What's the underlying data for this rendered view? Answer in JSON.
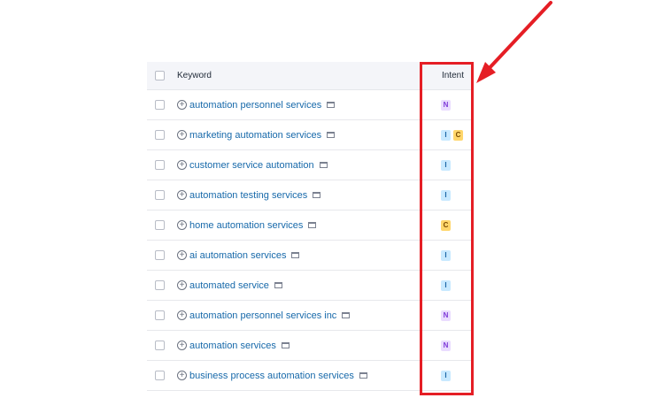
{
  "table": {
    "header": {
      "keyword_label": "Keyword",
      "intent_label": "Intent"
    },
    "rows": [
      {
        "keyword": "automation personnel services",
        "intents": [
          "N"
        ]
      },
      {
        "keyword": "marketing automation services",
        "intents": [
          "I",
          "C"
        ]
      },
      {
        "keyword": "customer service automation",
        "intents": [
          "I"
        ]
      },
      {
        "keyword": "automation testing services",
        "intents": [
          "I"
        ]
      },
      {
        "keyword": "home automation services",
        "intents": [
          "C"
        ]
      },
      {
        "keyword": "ai automation services",
        "intents": [
          "I"
        ]
      },
      {
        "keyword": "automated service",
        "intents": [
          "I"
        ]
      },
      {
        "keyword": "automation personnel services inc",
        "intents": [
          "N"
        ]
      },
      {
        "keyword": "automation services",
        "intents": [
          "N"
        ]
      },
      {
        "keyword": "business process automation services",
        "intents": [
          "I"
        ]
      }
    ]
  },
  "colors": {
    "keyword_link": "#1769aa",
    "highlight_red": "#e51e25",
    "badge_I": "#c8e9ff",
    "badge_C": "#ffd66b",
    "badge_N": "#eadcff"
  }
}
